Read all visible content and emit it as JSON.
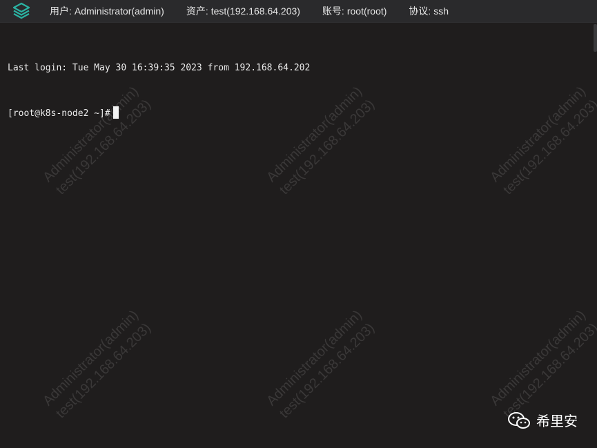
{
  "header": {
    "user_label": "用户:",
    "user_value": "Administrator(admin)",
    "asset_label": "资产:",
    "asset_value": "test(192.168.64.203)",
    "account_label": "账号:",
    "account_value": "root(root)",
    "protocol_label": "协议:",
    "protocol_value": "ssh",
    "logo_icon": "stack-layers-icon",
    "accent_color": "#2bb3a3"
  },
  "terminal": {
    "lines": [
      "Last login: Tue May 30 16:39:35 2023 from 192.168.64.202",
      "[root@k8s-node2 ~]#"
    ]
  },
  "watermark": {
    "line1": "Administrator(admin)",
    "line2": "test(192.168.64.203)"
  },
  "badge": {
    "icon": "wechat-icon",
    "text": "希里安"
  }
}
